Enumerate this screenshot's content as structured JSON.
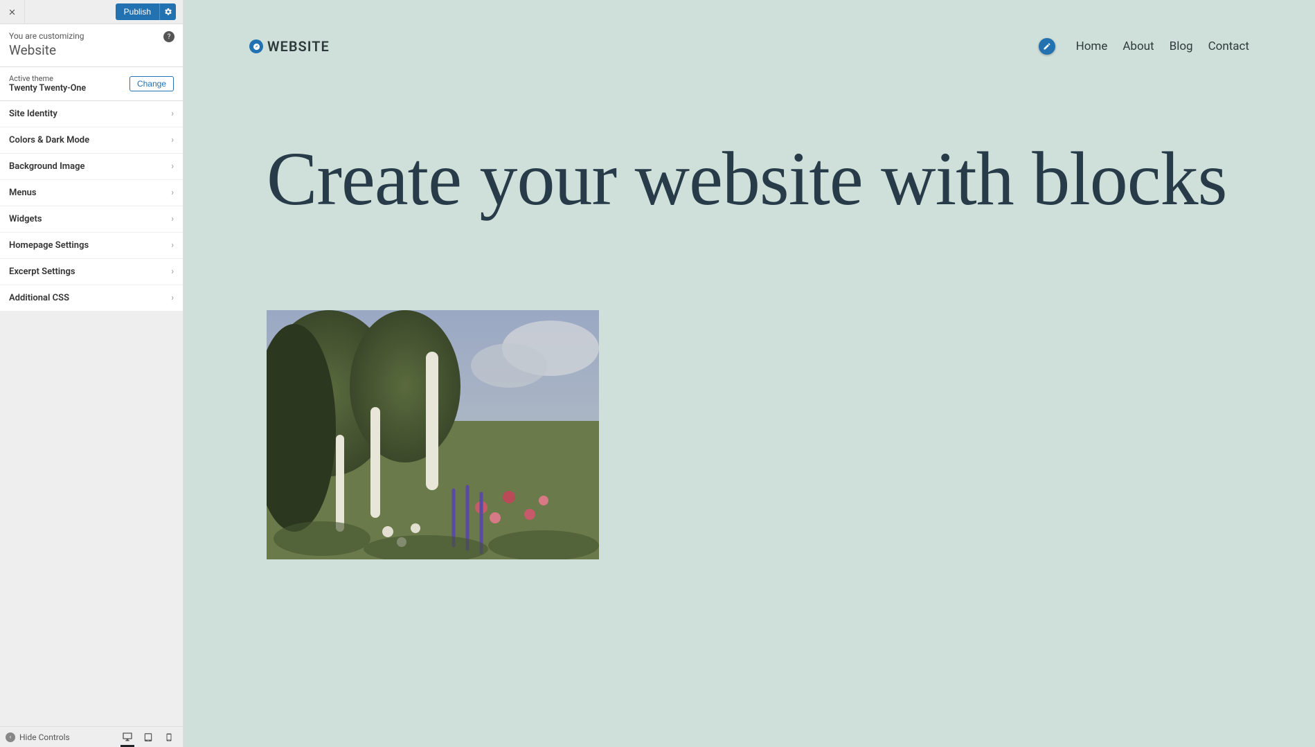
{
  "sidebar": {
    "publish_label": "Publish",
    "customizing_label": "You are customizing",
    "customizing_target": "Website",
    "active_theme_label": "Active theme",
    "active_theme_name": "Twenty Twenty-One",
    "change_label": "Change",
    "panels": [
      "Site Identity",
      "Colors & Dark Mode",
      "Background Image",
      "Menus",
      "Widgets",
      "Homepage Settings",
      "Excerpt Settings",
      "Additional CSS"
    ],
    "hide_controls_label": "Hide Controls"
  },
  "preview": {
    "site_title": "WEBSITE",
    "nav": [
      "Home",
      "About",
      "Blog",
      "Contact"
    ],
    "hero_title": "Create your website with blocks"
  }
}
